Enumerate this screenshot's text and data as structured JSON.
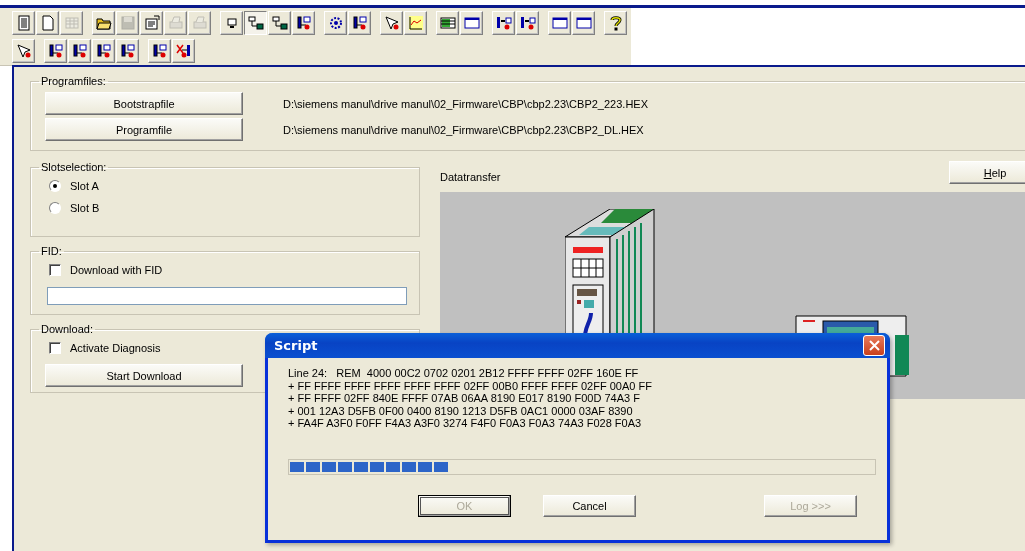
{
  "toolbar_rows": [
    {
      "groups": [
        [
          {
            "disabled": false,
            "pressed": false
          },
          {
            "disabled": false,
            "pressed": false
          },
          {
            "disabled": true,
            "pressed": false
          }
        ],
        [
          {
            "disabled": false,
            "pressed": false
          },
          {
            "disabled": true,
            "pressed": false
          },
          {
            "disabled": false,
            "pressed": false
          },
          {
            "disabled": true,
            "pressed": false
          },
          {
            "disabled": true,
            "pressed": false
          }
        ],
        [
          {
            "disabled": false,
            "pressed": false
          },
          {
            "disabled": false,
            "pressed": true
          },
          {
            "disabled": false,
            "pressed": false
          },
          {
            "disabled": false,
            "pressed": false
          }
        ],
        [
          {
            "disabled": false,
            "pressed": false
          },
          {
            "disabled": false,
            "pressed": false
          }
        ],
        [
          {
            "disabled": false,
            "pressed": false
          },
          {
            "disabled": false,
            "pressed": false
          }
        ],
        [
          {
            "disabled": false,
            "pressed": false
          },
          {
            "disabled": false,
            "pressed": false
          }
        ],
        [
          {
            "disabled": false,
            "pressed": false
          },
          {
            "disabled": false,
            "pressed": false
          }
        ],
        [
          {
            "disabled": false,
            "pressed": false
          },
          {
            "disabled": false,
            "pressed": false
          }
        ],
        [
          {
            "disabled": false,
            "pressed": false
          }
        ]
      ]
    },
    {
      "groups": [
        [
          {
            "disabled": false,
            "pressed": false
          }
        ],
        [
          {
            "disabled": false,
            "pressed": false
          },
          {
            "disabled": false,
            "pressed": false
          },
          {
            "disabled": false,
            "pressed": false
          },
          {
            "disabled": false,
            "pressed": false
          }
        ],
        [
          {
            "disabled": false,
            "pressed": false
          },
          {
            "disabled": false,
            "pressed": false
          }
        ]
      ]
    }
  ],
  "programfiles": {
    "title": "Programfiles:",
    "files": [
      {
        "button": "Bootstrapfile",
        "path": "D:\\siemens manul\\drive manul\\02_Firmware\\CBP\\cbp2.23\\CBP2_223.HEX"
      },
      {
        "button": "Programfile",
        "path": "D:\\siemens manul\\drive manul\\02_Firmware\\CBP\\cbp2.23\\CBP2_DL.HEX"
      }
    ]
  },
  "slotselection": {
    "title": "Slotselection:",
    "options": [
      {
        "label": "Slot A",
        "selected": true
      },
      {
        "label": "Slot B",
        "selected": false
      }
    ]
  },
  "fid": {
    "title": "FID:",
    "checkbox": {
      "label": "Download with FID",
      "checked": false
    }
  },
  "download": {
    "title": "Download:",
    "checkbox": {
      "label": "Activate Diagnosis",
      "checked": false
    },
    "button": "Start Download"
  },
  "datatransfer": {
    "title": "Datatransfer",
    "help_button": "Help"
  },
  "dialog": {
    "title": "Script",
    "lines": [
      "Line 24:   REM  4000 00C2 0702 0201 2B12 FFFF FFFF 02FF 160E FF",
      "+ FF FFFF FFFF FFFF FFFF FFFF 02FF 00B0 FFFF FFFF 02FF 00A0 FF",
      "+ FF FFFF 02FF 840E FFFF 07AB 06AA 8190 E017 8190 F00D 74A3 F",
      "+ 001 12A3 D5FB 0F00 0400 8190 1213 D5FB 0AC1 0000 03AF 8390",
      "+ FA4F A3F0 F0FF F4A3 A3F0 3274 F4F0 F0A3 F0A3 74A3 F028 F0A3"
    ],
    "progress": {
      "level": 0.27
    },
    "buttons": [
      {
        "label": "OK",
        "disabled": true,
        "focused": true
      },
      {
        "label": "Cancel",
        "disabled": false,
        "focused": false
      },
      {
        "label": "Log >>>",
        "disabled": true,
        "focused": false
      }
    ]
  }
}
